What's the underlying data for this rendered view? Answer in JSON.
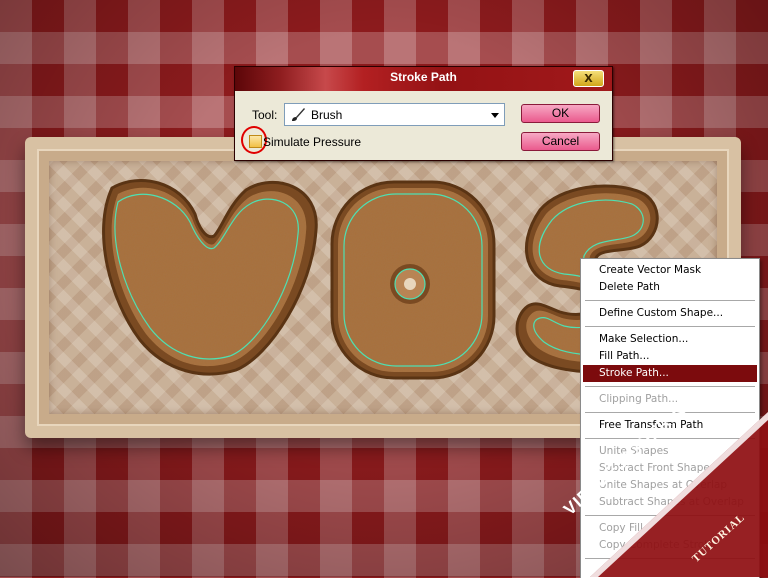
{
  "dialog": {
    "title": "Stroke Path",
    "close_label": "X",
    "tool_label": "Tool:",
    "tool_value": "Brush",
    "ok_label": "OK",
    "cancel_label": "Cancel",
    "simulate_pressure_label": "Simulate Pressure",
    "simulate_pressure_checked": false
  },
  "menu": {
    "items": [
      {
        "label": "Create Vector Mask",
        "enabled": true
      },
      {
        "label": "Delete Path",
        "enabled": true
      },
      {
        "label": "Define Custom Shape...",
        "enabled": true
      },
      {
        "label": "Make Selection...",
        "enabled": true
      },
      {
        "label": "Fill Path...",
        "enabled": true
      },
      {
        "label": "Stroke Path...",
        "enabled": true,
        "selected": true
      },
      {
        "label": "Clipping Path...",
        "enabled": false
      },
      {
        "label": "Free Transform Path",
        "enabled": true
      },
      {
        "label": "Unite Shapes",
        "enabled": false
      },
      {
        "label": "Subtract Front Shape",
        "enabled": false
      },
      {
        "label": "Unite Shapes at Overlap",
        "enabled": false
      },
      {
        "label": "Subtract Shapes at Overlap",
        "enabled": false
      },
      {
        "label": "Copy Fill",
        "enabled": false
      },
      {
        "label": "Copy Complete Stroke",
        "enabled": false
      }
    ]
  },
  "watermark": {
    "site": "VIETDESIGNER.NET",
    "tag": "TUTORIAL"
  },
  "colors": {
    "background": "#8d1b1d",
    "accent_red": "#7c0b0d",
    "cookie": "#a8703e",
    "path_stroke": "#4ee0b2",
    "button_pink": "#ea5a8d"
  }
}
